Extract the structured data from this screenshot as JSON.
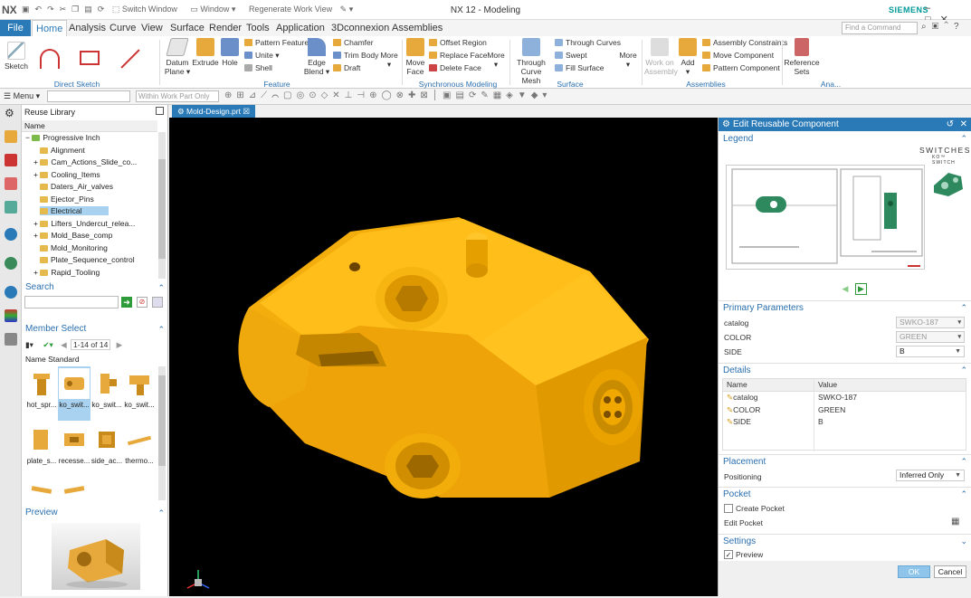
{
  "titlebar": {
    "logo": "NX",
    "switch_window": "Switch Window",
    "window_menu": "Window ▾",
    "regenerate": "Regenerate Work View",
    "title": "NX 12 - Modeling",
    "brand": "SIEMENS"
  },
  "tabs": [
    "File",
    "Home",
    "Analysis",
    "Curve",
    "View",
    "Surface",
    "Render",
    "Tools",
    "Application",
    "3Dconnexion",
    "Assemblies"
  ],
  "active_tab": "Home",
  "search_command_placeholder": "Find a Command",
  "ribbon": {
    "sketch": "Sketch",
    "direct_sketch_label": "Direct Sketch",
    "datum_plane": [
      "Datum",
      "Plane ▾"
    ],
    "extrude": "Extrude",
    "hole": "Hole",
    "pattern_feature": "Pattern Feature",
    "unite": "Unite ▾",
    "shell": "Shell",
    "edge_blend": [
      "Edge",
      "Blend ▾"
    ],
    "chamfer": "Chamfer",
    "trim_body": "Trim Body",
    "draft": "Draft",
    "more1": "More",
    "feature_label": "Feature",
    "move_face": [
      "Move",
      "Face"
    ],
    "offset_region": "Offset Region",
    "replace_face": "Replace Face",
    "delete_face": "Delete Face",
    "more2": "More",
    "sync_label": "Synchronous Modeling",
    "through_curve_mesh": [
      "Through",
      "Curve Mesh"
    ],
    "through_curves": "Through Curves",
    "swept": "Swept",
    "fill_surface": "Fill Surface",
    "more3": "More",
    "surface_label": "Surface",
    "work_on_assembly": [
      "Work on",
      "Assembly"
    ],
    "add": "Add",
    "assembly_constraints": "Assembly Constraints",
    "move_component": "Move Component",
    "pattern_component": "Pattern Component",
    "assemblies_label": "Assemblies",
    "reference_sets": [
      "Reference",
      "Sets"
    ],
    "ana_label": "Ana..."
  },
  "toolbar": {
    "menu": "Menu ▾",
    "filter2": "Within Work Part Only"
  },
  "library": {
    "title": "Reuse Library",
    "name_col": "Name",
    "root": "Progressive Inch",
    "items": [
      "Alignment",
      "Cam_Actions_Slide_co...",
      "Cooling_Items",
      "Daters_Air_valves",
      "Ejector_Pins",
      "Electrical",
      "Lifters_Undercut_relea...",
      "Mold_Base_comp",
      "Mold_Monitoring",
      "Plate_Sequence_control",
      "Rapid_Tooling"
    ],
    "selected_item": "Electrical",
    "search_title": "Search",
    "member_select_title": "Member Select",
    "page_info": "1-14 of 14",
    "member_cols": [
      "Name",
      "Standard"
    ],
    "members": [
      "hot_spr...",
      "ko_swit...",
      "ko_swit...",
      "ko_swit...",
      "plate_s...",
      "recesse...",
      "side_ac...",
      "thermo..."
    ],
    "selected_member": 1,
    "preview_title": "Preview"
  },
  "doc_tab": "Mold-Design.prt",
  "panel": {
    "title": "Edit Reusable Component",
    "legend": "Legend",
    "legend_brand": "SWITCHES",
    "legend_sub": "KO™ SWITCH",
    "primary_params": "Primary Parameters",
    "params": [
      {
        "label": "catalog",
        "value": "SWKO-187",
        "enabled": false
      },
      {
        "label": "COLOR",
        "value": "GREEN",
        "enabled": false
      },
      {
        "label": "SIDE",
        "value": "B",
        "enabled": true
      }
    ],
    "details": "Details",
    "detail_cols": [
      "Name",
      "Value"
    ],
    "detail_rows": [
      {
        "name": "catalog",
        "value": "SWKO-187"
      },
      {
        "name": "COLOR",
        "value": "GREEN"
      },
      {
        "name": "SIDE",
        "value": "B"
      }
    ],
    "placement": "Placement",
    "positioning_label": "Positioning",
    "positioning_value": "Inferred Only",
    "pocket": "Pocket",
    "create_pocket": "Create Pocket",
    "edit_pocket": "Edit Pocket",
    "settings": "Settings",
    "preview": "Preview",
    "ok": "OK",
    "cancel": "Cancel"
  },
  "colors": {
    "accent": "#2a7ab8",
    "part": "#f5b400",
    "viewport": "#000000"
  }
}
